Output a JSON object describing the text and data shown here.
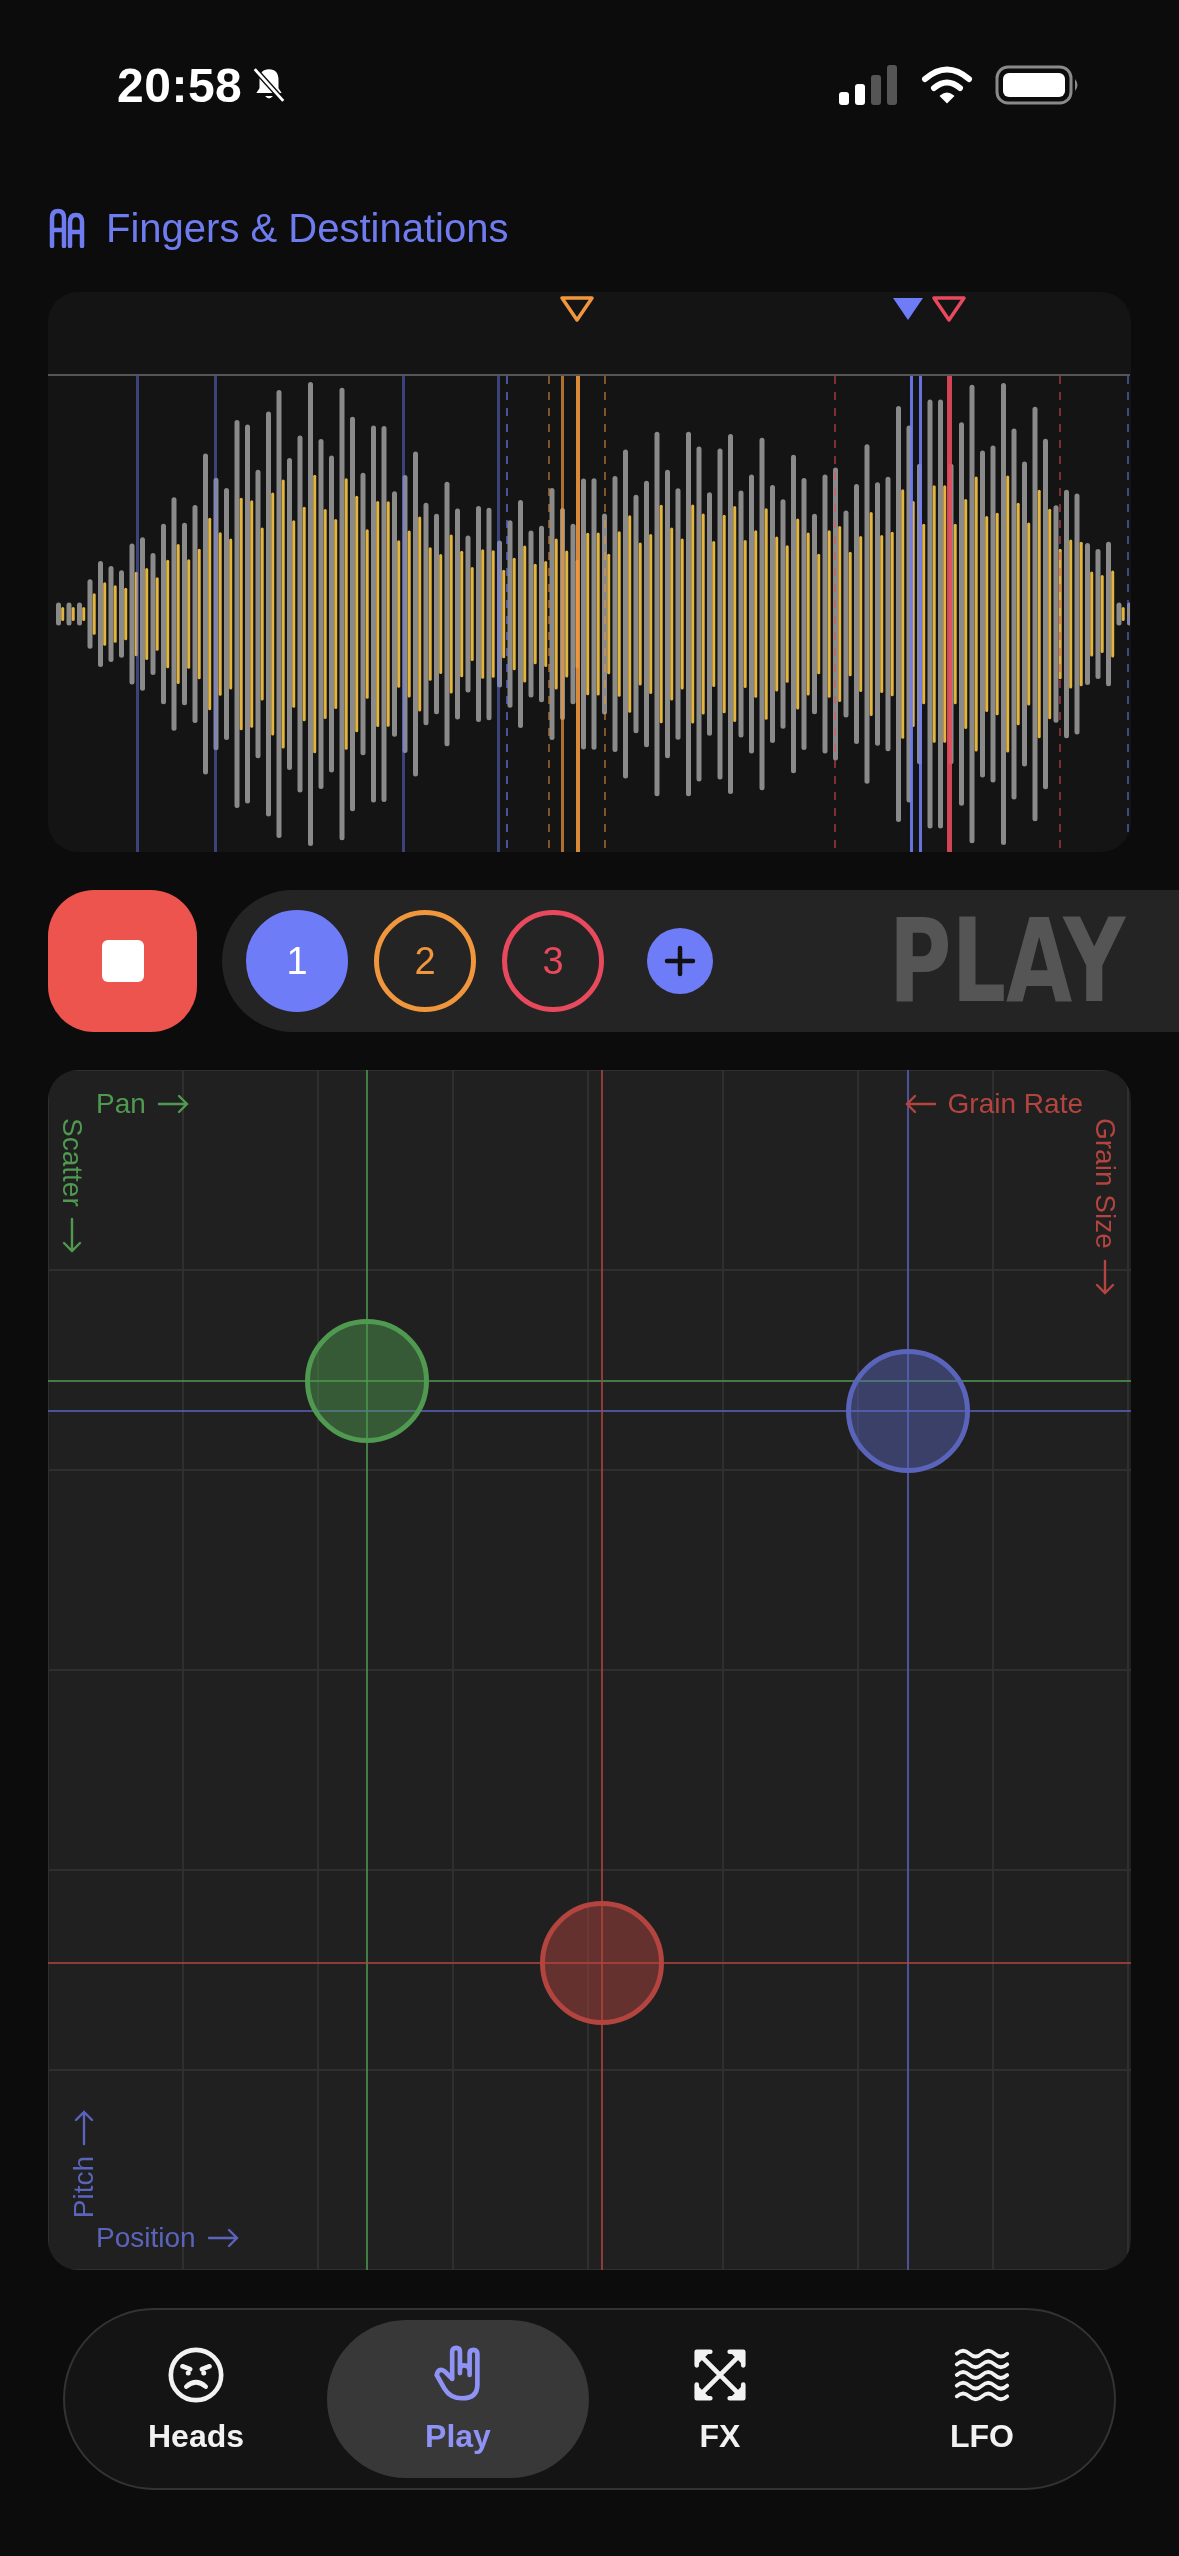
{
  "status_bar": {
    "time": "20:58"
  },
  "header": {
    "title": "Fingers & Destinations"
  },
  "fingers": [
    {
      "label": "1",
      "color": "#6f7cf7",
      "selected": true
    },
    {
      "label": "2",
      "color": "#f0963c",
      "selected": false
    },
    {
      "label": "3",
      "color": "#e8495c",
      "selected": false
    }
  ],
  "mode_label": "PLAY",
  "pad": {
    "destinations": [
      {
        "x_label": "Pan",
        "y_label": "Scatter",
        "color": "#4f9a50"
      },
      {
        "x_label": "Position",
        "y_label": "Pitch",
        "color": "#5a64bb"
      },
      {
        "x_label": "Grain Rate",
        "y_label": "Grain Size",
        "color": "#b4443f"
      }
    ]
  },
  "tabs": [
    {
      "label": "Heads",
      "kind": "face",
      "selected": false
    },
    {
      "label": "Play",
      "kind": "hand",
      "selected": true
    },
    {
      "label": "FX",
      "kind": "expand",
      "selected": false
    },
    {
      "label": "LFO",
      "kind": "waves",
      "selected": false
    }
  ]
}
